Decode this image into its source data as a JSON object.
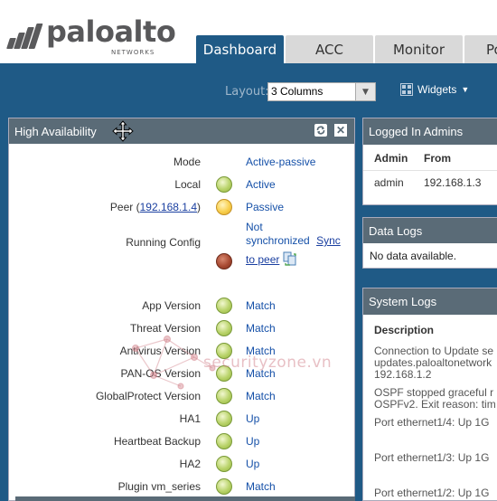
{
  "brand": {
    "name": "paloalto",
    "sub": "NETWORKS"
  },
  "nav": {
    "tabs": [
      {
        "label": "Dashboard",
        "active": true
      },
      {
        "label": "ACC",
        "active": false
      },
      {
        "label": "Monitor",
        "active": false
      },
      {
        "label": "Po",
        "active": false
      }
    ]
  },
  "toolbar": {
    "layout_label": "Layout:",
    "layout_value": "3 Columns",
    "widgets_label": "Widgets"
  },
  "ha": {
    "title": "High Availability",
    "rows": [
      {
        "label": "Mode",
        "status": "",
        "value": "Active-passive"
      },
      {
        "label": "Local",
        "status": "green",
        "value": "Active"
      },
      {
        "label_prefix": "Peer (",
        "label_link": "192.168.1.4",
        "label_suffix": ")",
        "status": "yellow",
        "value": "Passive"
      },
      {
        "label": "Running Config",
        "status": "red",
        "value_line1": "Not",
        "value_line2": "synchronized",
        "link1": "Sync",
        "link2": "to peer"
      },
      {
        "label": "App Version",
        "status": "green",
        "value": "Match"
      },
      {
        "label": "Threat Version",
        "status": "green",
        "value": "Match"
      },
      {
        "label": "Antivirus Version",
        "status": "green",
        "value": "Match"
      },
      {
        "label": "PAN-OS Version",
        "status": "green",
        "value": "Match"
      },
      {
        "label": "GlobalProtect Version",
        "status": "green",
        "value": "Match"
      },
      {
        "label": "HA1",
        "status": "green",
        "value": "Up"
      },
      {
        "label": "Heartbeat Backup",
        "status": "green",
        "value": "Up"
      },
      {
        "label": "HA2",
        "status": "green",
        "value": "Up"
      },
      {
        "label": "Plugin vm_series",
        "status": "green",
        "value": "Match"
      }
    ]
  },
  "admins": {
    "title": "Logged In Admins",
    "col_admin": "Admin",
    "col_from": "From",
    "rows": [
      {
        "admin": "admin",
        "from": "192.168.1.3"
      }
    ]
  },
  "data_logs": {
    "title": "Data Logs",
    "empty": "No data available."
  },
  "system_logs": {
    "title": "System Logs",
    "col_desc": "Description",
    "entries": [
      "Connection to Update se",
      "updates.paloaltonetwork",
      "192.168.1.2",
      "OSPF stopped graceful r",
      "OSPFv2. Exit reason: tim",
      "Port ethernet1/4: Up 1G",
      "Port ethernet1/3: Up 1G",
      "Port ethernet1/2: Up 1G"
    ]
  },
  "watermark": "securityzone.vn",
  "colors": {
    "nav_blue": "#1f5a86",
    "panel_head": "#5a6b77",
    "value_blue": "#1550a8"
  }
}
